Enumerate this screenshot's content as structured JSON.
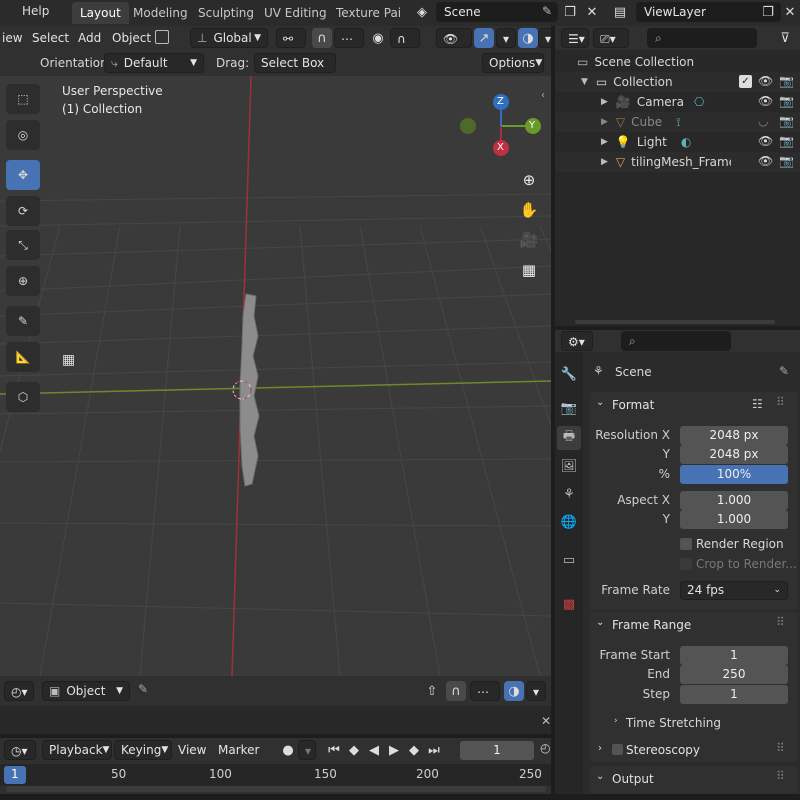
{
  "menu": {
    "view_partial": "iew",
    "help": "Help"
  },
  "workspaces": [
    "Layout",
    "Modeling",
    "Sculpting",
    "UV Editing",
    "Texture Paint"
  ],
  "scene": {
    "name": "Scene",
    "view_layer": "ViewLayer"
  },
  "viewport_header": {
    "menus": [
      "Select",
      "Add",
      "Object"
    ],
    "transform_orientation": "Global",
    "orientation_label": "Orientation:",
    "orientation_value": "Default",
    "drag_label": "Drag:",
    "drag_value": "Select Box",
    "options": "Options"
  },
  "viewport": {
    "perspective": "User Perspective",
    "collection": "(1) Collection"
  },
  "gizmo": {
    "z": "Z",
    "y": "Y",
    "x": "X"
  },
  "outliner": {
    "root": "Scene Collection",
    "collection": "Collection",
    "items": [
      {
        "name": "Camera",
        "color": "#e8a04a"
      },
      {
        "name": "Cube",
        "color": "#e8a04a",
        "dim": true
      },
      {
        "name": "Light",
        "color": "#e8a04a"
      },
      {
        "name": "tilingMesh_Framer:",
        "color": "#e8a04a"
      }
    ]
  },
  "properties": {
    "context": "Scene",
    "format_title": "Format",
    "res_x_label": "Resolution X",
    "res_x": "2048 px",
    "res_y_label": "Y",
    "res_y": "2048 px",
    "pct_label": "%",
    "pct": "100%",
    "aspect_x_label": "Aspect X",
    "aspect_x": "1.000",
    "aspect_y_label": "Y",
    "aspect_y": "1.000",
    "render_region": "Render Region",
    "crop": "Crop to Render...",
    "frame_rate_label": "Frame Rate",
    "frame_rate": "24 fps",
    "frame_range_title": "Frame Range",
    "frame_start_label": "Frame Start",
    "frame_start": "1",
    "end_label": "End",
    "end": "250",
    "step_label": "Step",
    "step": "1",
    "time_stretching": "Time Stretching",
    "stereoscopy": "Stereoscopy",
    "output": "Output"
  },
  "viewport_footer": {
    "mode": "Object"
  },
  "timeline": {
    "menus": [
      "Playback",
      "Keying",
      "View",
      "Marker"
    ],
    "current_frame": "1",
    "ticks": [
      "1",
      "50",
      "100",
      "150",
      "200",
      "250"
    ]
  },
  "colors": {
    "accent": "#4772b3",
    "x_axis": "#a0303a",
    "y_axis": "#6a9a2a",
    "z_axis": "#2f6fc0"
  }
}
